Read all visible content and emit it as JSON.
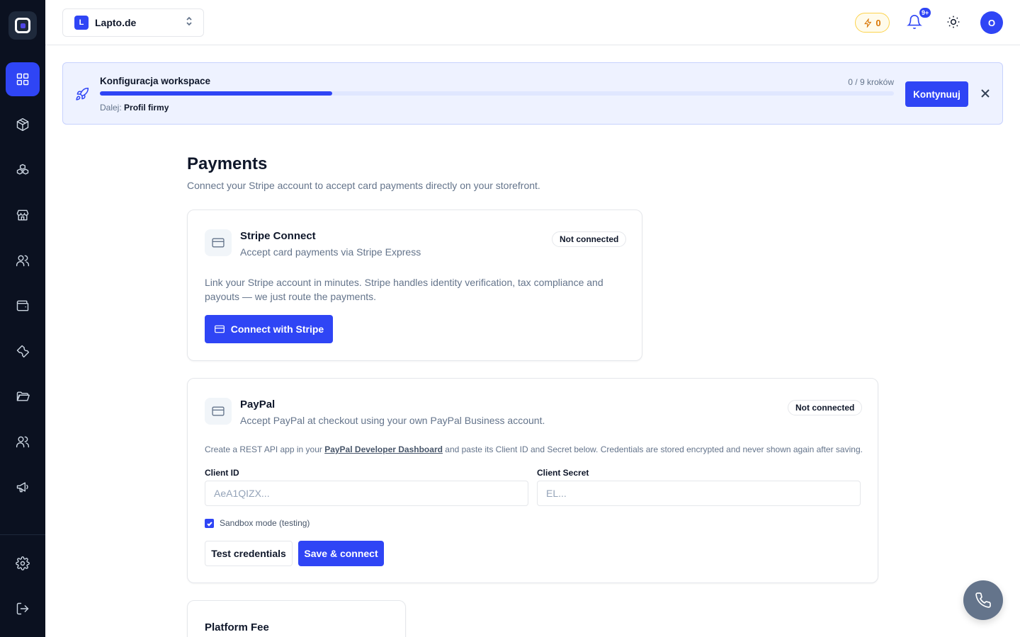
{
  "workspace": {
    "badge": "L",
    "name": "Lapto.de"
  },
  "topbar": {
    "credits": "0",
    "notifications_badge": "9+",
    "avatar_initial": "O"
  },
  "setup_banner": {
    "title": "Konfiguracja workspace",
    "steps": "0 / 9 kroków",
    "progress": 0.293,
    "next_label": "Dalej:",
    "next_value": "Profil firmy",
    "continue_label": "Kontynuuj"
  },
  "page": {
    "title": "Payments",
    "subtitle": "Connect your Stripe account to accept card payments directly on your storefront."
  },
  "stripe": {
    "title": "Stripe Connect",
    "description": "Accept card payments via Stripe Express",
    "status": "Not connected",
    "body": "Link your Stripe account in minutes. Stripe handles identity verification, tax compliance and payouts — we just route the payments.",
    "button_label": "Connect with Stripe"
  },
  "paypal": {
    "title": "PayPal",
    "description": "Accept PayPal at checkout using your own PayPal Business account.",
    "status": "Not connected",
    "note_prefix": "Create a REST API app in your ",
    "note_link": "PayPal Developer Dashboard",
    "note_suffix": " and paste its Client ID and Secret below. Credentials are stored encrypted and never shown again after saving.",
    "client_id_label": "Client ID",
    "client_id_placeholder": "AeA1QIZX...",
    "client_id_value": "",
    "client_secret_label": "Client Secret",
    "client_secret_placeholder": "EL...",
    "client_secret_value": "",
    "sandbox_label": "Sandbox mode (testing)",
    "sandbox_checked": true,
    "test_label": "Test credentials",
    "save_label": "Save & connect"
  },
  "platform_fee": {
    "title": "Platform Fee"
  },
  "colors": {
    "accent": "#2f45f5",
    "sidebar": "#0b1120",
    "banner_bg": "#eef2ff",
    "credits": "#d97706"
  },
  "icons": {
    "sidebar": [
      "dashboard-icon",
      "package-icon",
      "boxes-icon",
      "store-icon",
      "users-icon",
      "wallet-icon",
      "wrench-icon",
      "folder-icon",
      "team-icon",
      "megaphone-icon",
      "briefcase-icon",
      "settings-icon",
      "logout-icon"
    ],
    "fab": "phone-icon"
  }
}
